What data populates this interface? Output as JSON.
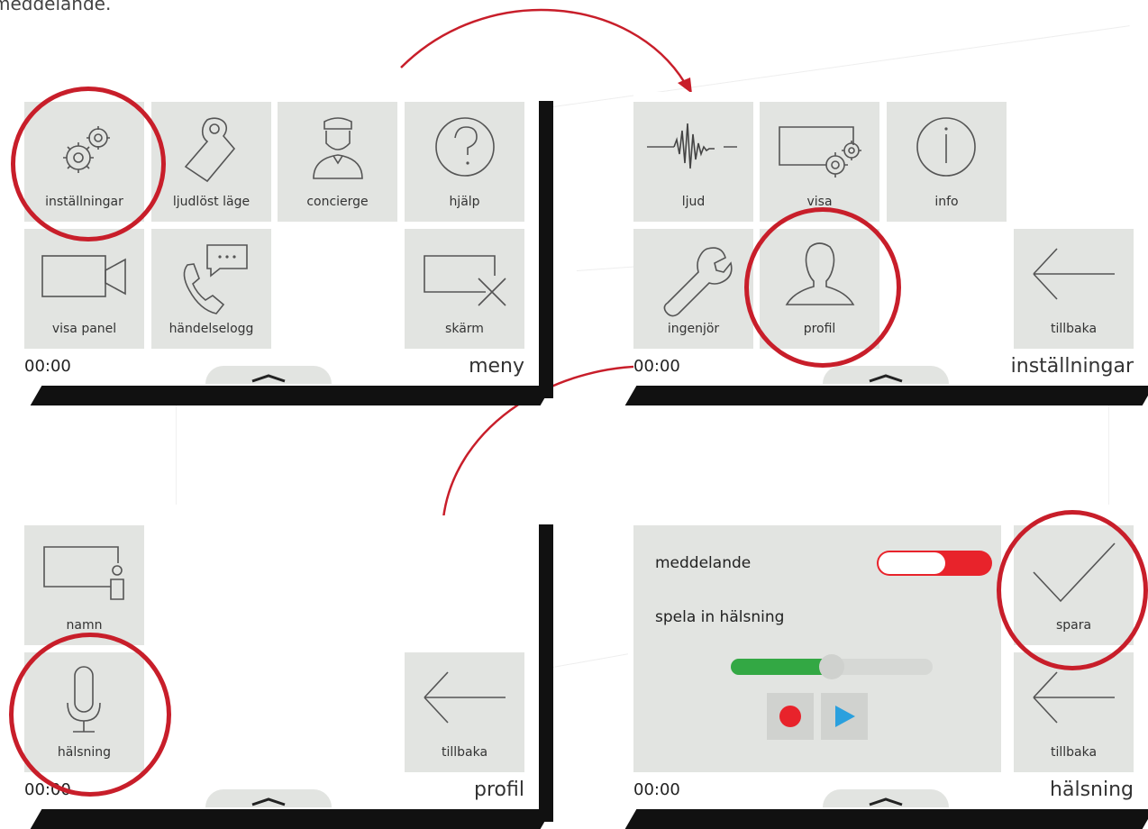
{
  "caption": "meddelande.",
  "screens": {
    "menu": {
      "title": "meny",
      "clock": "00:00",
      "tiles": [
        {
          "label": "inställningar",
          "icon": "gears-icon"
        },
        {
          "label": "ljudlöst läge",
          "icon": "door-hanger-icon"
        },
        {
          "label": "concierge",
          "icon": "concierge-icon"
        },
        {
          "label": "hjälp",
          "icon": "question-icon"
        },
        {
          "label": "visa panel",
          "icon": "video-camera-icon"
        },
        {
          "label": "händelselogg",
          "icon": "phone-message-icon"
        },
        {
          "label": "skärm",
          "icon": "screen-off-icon"
        }
      ]
    },
    "settings": {
      "title": "inställningar",
      "clock": "00:00",
      "tiles": [
        {
          "label": "ljud",
          "icon": "waveform-icon"
        },
        {
          "label": "visa",
          "icon": "display-gears-icon"
        },
        {
          "label": "info",
          "icon": "info-icon"
        },
        {
          "label": "ingenjör",
          "icon": "wrench-icon"
        },
        {
          "label": "profil",
          "icon": "person-icon"
        },
        {
          "label": "tillbaka",
          "icon": "back-arrow-icon"
        }
      ]
    },
    "profile": {
      "title": "profil",
      "clock": "00:00",
      "tiles": [
        {
          "label": "namn",
          "icon": "name-display-icon"
        },
        {
          "label": "hälsning",
          "icon": "microphone-icon"
        },
        {
          "label": "tillbaka",
          "icon": "back-arrow-icon"
        }
      ]
    },
    "greeting": {
      "title": "hälsning",
      "clock": "00:00",
      "message_label": "meddelande",
      "record_label": "spela in hälsning",
      "message_toggle_on": true,
      "playback_progress": 0.5,
      "tiles": [
        {
          "label": "spara",
          "icon": "checkmark-icon"
        },
        {
          "label": "tillbaka",
          "icon": "back-arrow-icon"
        }
      ]
    }
  },
  "colors": {
    "highlight": "#c81e2a",
    "tile": "#e2e4e1",
    "toggle_on": "#e8232b",
    "slider_fill": "#33a844",
    "record": "#e8232b",
    "play": "#2aa0de"
  }
}
